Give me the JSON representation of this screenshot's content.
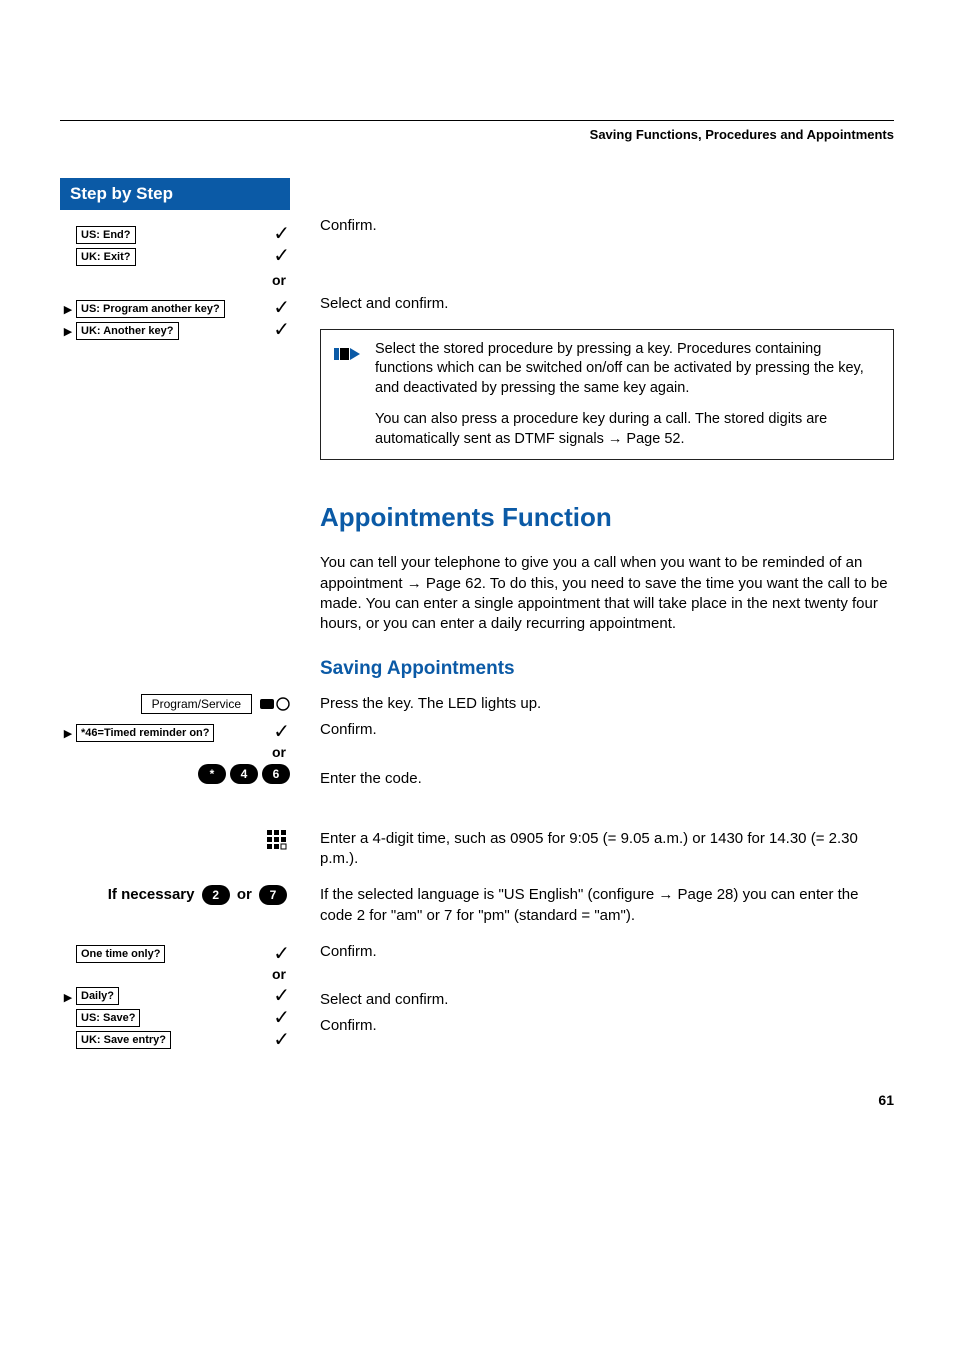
{
  "running_head": "Saving Functions, Procedures and Appointments",
  "page_number": "61",
  "left": {
    "step_banner": "Step by Step",
    "end_us": "US: End?",
    "end_uk": "UK: Exit?",
    "or": "or",
    "prog_us": "US: Program another key?",
    "prog_uk": "UK: Another key?",
    "program_service": "Program/Service",
    "timed_reminder": "46=Timed reminder on?",
    "key_star": "*",
    "key_4": "4",
    "key_6": "6",
    "if_necessary": "If necessary",
    "key_2": "2",
    "ifnec_or": "or",
    "key_7": "7",
    "one_time": "One time only?",
    "daily": "Daily?",
    "save_us": "US: Save?",
    "save_uk": "UK: Save entry?"
  },
  "right": {
    "confirm": "Confirm.",
    "select_confirm": "Select and confirm.",
    "note_p1": "Select the stored procedure by pressing a key. Procedures containing functions which can be switched on/off can be activated by pressing the key, and deactivated by pressing the same key again.",
    "note_p2a": "You can also press a procedure key during a call. The stored digits are automatically sent as DTMF signals ",
    "note_p2_link": "Page 52.",
    "sec_heading": "Appointments Function",
    "appt_body_a": "You can tell your telephone to give you a call when you want to be reminded of an appointment ",
    "appt_link": "Page 62.",
    "appt_body_b": " To do this, you need to save the time you want the call to be made. You can enter a single appointment that will take place in the next twenty four hours, or you can enter a daily recurring appointment.",
    "sub_heading": "Saving Appointments",
    "press_key": "Press the key. The LED lights up.",
    "enter_code": "Enter the code.",
    "enter_time": "Enter a 4-digit time, such as 0905 for 9:05 (= 9.05 a.m.) or 1430 for 14.30 (= 2.30 p.m.).",
    "lang_a": "If the selected language is \"US English\" (configure ",
    "lang_link": "Page 28",
    "lang_b": ") you can enter the code 2 for \"am\" or 7 for \"pm\" (standard = \"am\")."
  }
}
